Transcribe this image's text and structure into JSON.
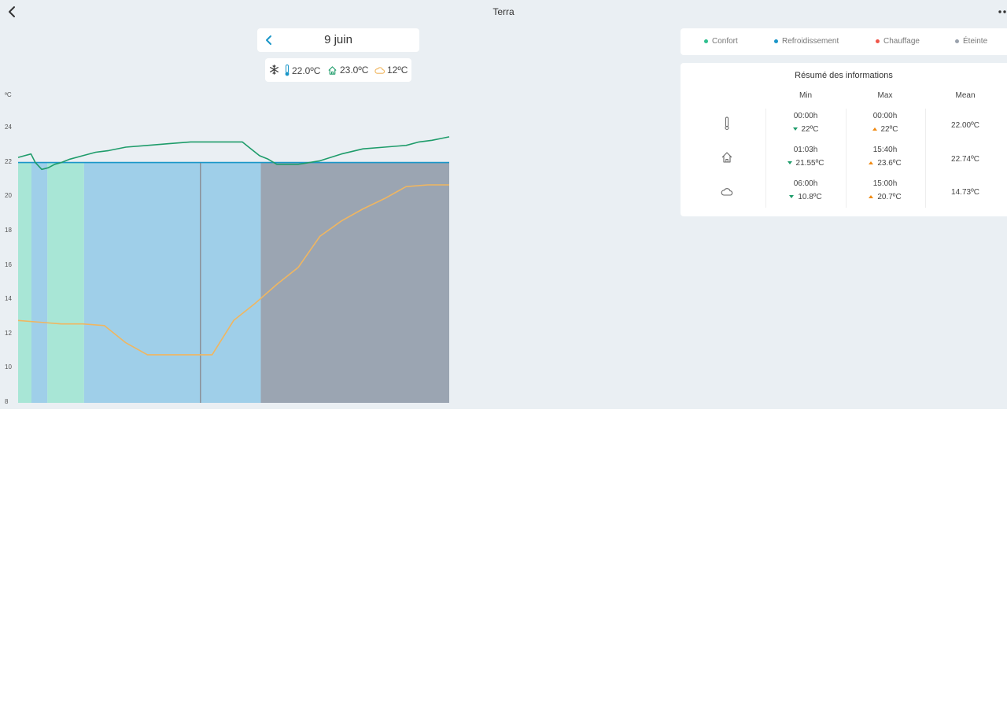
{
  "header": {
    "title": "Terra",
    "back_icon": "chevron-left-icon",
    "more_icon": "more-icon"
  },
  "date_nav": {
    "date": "9 juin",
    "prev_icon": "chevron-left-icon"
  },
  "current": {
    "mode_icon": "snowflake-icon",
    "setpoint": "22.0ºC",
    "indoor": "23.0ºC",
    "outdoor": "12ºC"
  },
  "legend": [
    {
      "label": "Confort",
      "color": "#2fbf8f"
    },
    {
      "label": "Refroidissement",
      "color": "#1a96c8"
    },
    {
      "label": "Chauffage",
      "color": "#f0564a"
    },
    {
      "label": "Éteinte",
      "color": "#9aa2ad"
    }
  ],
  "info": {
    "title": "Résumé des informations",
    "columns": [
      "Min",
      "Max",
      "Mean"
    ],
    "rows": [
      {
        "icon": "thermometer-icon",
        "min_time": "00:00h",
        "min_value": "22ºC",
        "max_time": "00:00h",
        "max_value": "22ºC",
        "mean": "22.00ºC"
      },
      {
        "icon": "home-icon",
        "min_time": "01:03h",
        "min_value": "21.55ºC",
        "max_time": "15:40h",
        "max_value": "23.6ºC",
        "mean": "22.74ºC"
      },
      {
        "icon": "cloud-icon",
        "min_time": "06:00h",
        "min_value": "10.8ºC",
        "max_time": "15:00h",
        "max_value": "20.7ºC",
        "mean": "14.73ºC"
      }
    ]
  },
  "chart_data": {
    "type": "line",
    "ylabel": "ºC",
    "ylim": [
      8,
      24
    ],
    "yticks": [
      "24",
      "22",
      "20",
      "18",
      "16",
      "14",
      "12",
      "10",
      "8"
    ],
    "grid": false,
    "x_domain": [
      0,
      100
    ],
    "mode_bands": [
      {
        "mode": "Confort",
        "from": 0,
        "to": 3.1,
        "color": "#a8e6d6"
      },
      {
        "mode": "Refroidissement",
        "from": 3.1,
        "to": 6.8,
        "color": "#9fcfe9"
      },
      {
        "mode": "Confort",
        "from": 6.8,
        "to": 15.3,
        "color": "#a8e6d6"
      },
      {
        "mode": "Refroidissement",
        "from": 15.3,
        "to": 56.3,
        "color": "#9fcfe9"
      },
      {
        "mode": "Éteinte",
        "from": 56.3,
        "to": 100,
        "color": "#9ba5b2"
      }
    ],
    "marker_x": 42.3,
    "series": [
      {
        "color": "#1a96c8",
        "x": [
          0,
          100
        ],
        "y": [
          22.0,
          22.0
        ]
      },
      {
        "color": "#1e9c6a",
        "x": [
          0,
          1.5,
          3,
          4,
          5.5,
          7,
          8.5,
          10,
          12,
          15,
          18,
          21,
          25,
          30,
          35,
          40,
          45,
          50,
          52,
          53.5,
          56,
          58,
          60,
          65,
          70,
          75,
          80,
          85,
          90,
          93,
          96,
          98,
          100
        ],
        "y": [
          22.3,
          22.4,
          22.5,
          22.0,
          21.6,
          21.7,
          21.9,
          22.0,
          22.2,
          22.4,
          22.6,
          22.7,
          22.9,
          23.0,
          23.1,
          23.2,
          23.2,
          23.2,
          23.2,
          22.9,
          22.4,
          22.2,
          21.9,
          21.9,
          22.1,
          22.5,
          22.8,
          22.9,
          23.0,
          23.2,
          23.3,
          23.4,
          23.5
        ]
      },
      {
        "color": "#f0b660",
        "x": [
          0,
          5,
          10,
          15,
          20,
          25,
          30,
          35,
          40,
          45,
          50,
          55,
          60,
          65,
          70,
          75,
          80,
          85,
          90,
          95,
          100
        ],
        "y": [
          12.8,
          12.7,
          12.6,
          12.6,
          12.5,
          11.5,
          10.8,
          10.8,
          10.8,
          10.8,
          12.8,
          13.8,
          14.9,
          15.9,
          17.7,
          18.6,
          19.3,
          19.9,
          20.6,
          20.7,
          20.7
        ]
      }
    ]
  }
}
